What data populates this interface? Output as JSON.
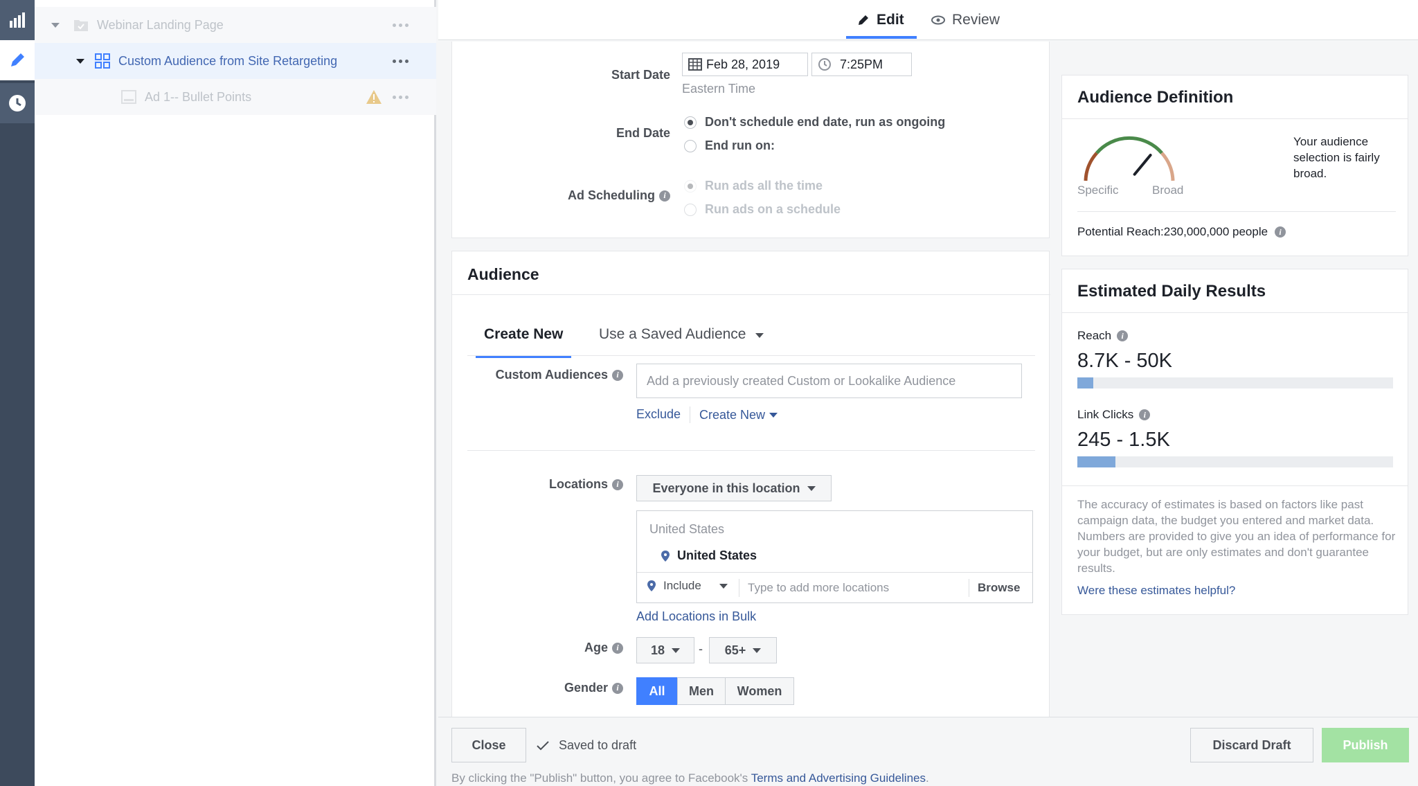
{
  "tree": {
    "items": [
      {
        "label": "Webinar Landing Page"
      },
      {
        "label": "Custom Audience from Site Retargeting"
      },
      {
        "label": "Ad 1-- Bullet Points"
      }
    ]
  },
  "tabs": {
    "edit": "Edit",
    "review": "Review"
  },
  "schedule": {
    "start_date_label": "Start Date",
    "start_date": "Feb 28, 2019",
    "start_time": "7:25PM",
    "timezone": "Eastern Time",
    "end_date_label": "End Date",
    "end_option_ongoing": "Don't schedule end date, run as ongoing",
    "end_option_on": "End run on:",
    "ad_scheduling_label": "Ad Scheduling",
    "scheduling_all_time": "Run ads all the time",
    "scheduling_on_schedule": "Run ads on a schedule"
  },
  "audience": {
    "title": "Audience",
    "tab_create_new": "Create New",
    "tab_saved": "Use a Saved Audience",
    "custom_audiences_label": "Custom Audiences",
    "custom_audiences_placeholder": "Add a previously created Custom or Lookalike Audience",
    "exclude": "Exclude",
    "create_new": "Create New",
    "locations_label": "Locations",
    "location_mode": "Everyone in this location",
    "location_group": "United States",
    "location_selected": "United States",
    "include": "Include",
    "locations_placeholder": "Type to add more locations",
    "browse": "Browse",
    "add_bulk": "Add Locations in Bulk",
    "age_label": "Age",
    "age_min": "18",
    "age_sep": "-",
    "age_max": "65+",
    "gender_label": "Gender",
    "gender_all": "All",
    "gender_men": "Men",
    "gender_women": "Women"
  },
  "definition": {
    "title": "Audience Definition",
    "specific": "Specific",
    "broad": "Broad",
    "note": "Your audience selection is fairly broad.",
    "potential_reach": "Potential Reach:230,000,000 people",
    "gauge_level": 0.72
  },
  "estimates": {
    "title": "Estimated Daily Results",
    "reach_label": "Reach",
    "reach_value": "8.7K - 50K",
    "reach_fill": 0.05,
    "clicks_label": "Link Clicks",
    "clicks_value": "245 - 1.5K",
    "clicks_fill": 0.12,
    "disclaimer": "The accuracy of estimates is based on factors like past campaign data, the budget you entered and market data. Numbers are provided to give you an idea of performance for your budget, but are only estimates and don't guarantee results.",
    "helpful_link": "Were these estimates helpful?"
  },
  "footer": {
    "close": "Close",
    "saved": "Saved to draft",
    "discard": "Discard Draft",
    "publish": "Publish",
    "terms_prefix": "By clicking the \"Publish\" button, you agree to Facebook's",
    "terms_link": "Terms and Advertising Guidelines",
    "terms_suffix": "."
  },
  "colors": {
    "accent": "#4080ff",
    "link": "#365899",
    "publish": "#a3e2a3",
    "rail": "#3d4a5c"
  }
}
